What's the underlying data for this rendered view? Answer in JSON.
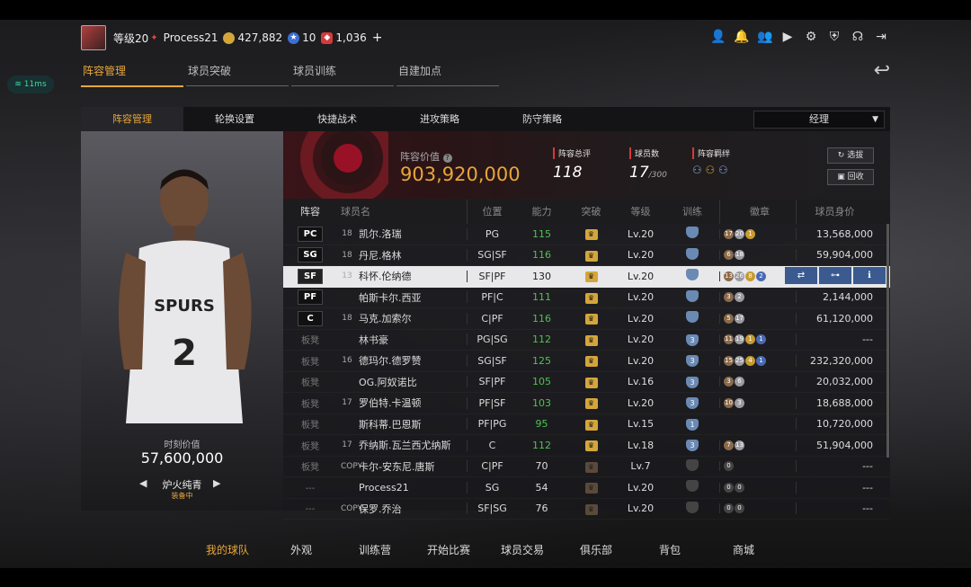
{
  "header": {
    "level_label": "等级20",
    "username": "Process21",
    "gold": "427,882",
    "stars": "10",
    "tickets": "1,036",
    "plus": "+"
  },
  "ping": "11ms",
  "main_tabs": [
    "阵容管理",
    "球员突破",
    "球员训练",
    "自建加点"
  ],
  "sub_tabs": [
    "阵容管理",
    "轮换设置",
    "快捷战术",
    "进攻策略",
    "防守策略"
  ],
  "manager_select": "经理",
  "team": {
    "value_label": "阵容价值",
    "value": "903,920,000",
    "rating_label": "阵容总评",
    "rating": "118",
    "count_label": "球员数",
    "count": "17",
    "count_max": "/300",
    "bond_label": "阵容羁绊",
    "btn_select": "选拔",
    "btn_recycle": "回收"
  },
  "player_card": {
    "jersey_team": "SPURS",
    "jersey_number": "2",
    "value_label": "时刻价值",
    "value": "57,600,000",
    "card_name": "炉火纯青",
    "card_status": "装备中"
  },
  "table": {
    "headers": [
      "阵容",
      "球员名",
      "位置",
      "能力",
      "突破",
      "等级",
      "训练",
      "徽章",
      "球员身价"
    ],
    "rows": [
      {
        "pos": "PC",
        "num": "18",
        "name": "凯尔.洛瑞",
        "position": "PG",
        "ability": "115",
        "level": "Lv.20",
        "train": "",
        "badges": [
          "17",
          "20",
          "1"
        ],
        "value": "13,568,000"
      },
      {
        "pos": "SG",
        "num": "18",
        "name": "丹尼.格林",
        "position": "SG|SF",
        "ability": "116",
        "level": "Lv.20",
        "train": "",
        "badges": [
          "6",
          "18"
        ],
        "value": "59,904,000"
      },
      {
        "pos": "SF",
        "num": "13",
        "name": "科怀.伦纳德",
        "position": "SF|PF",
        "ability": "130",
        "level": "Lv.20",
        "train": "",
        "badges": [
          "13",
          "26",
          "8",
          "2"
        ],
        "value": ""
      },
      {
        "pos": "PF",
        "num": "",
        "name": "帕斯卡尔.西亚",
        "position": "PF|C",
        "ability": "111",
        "level": "Lv.20",
        "train": "",
        "badges": [
          "3",
          "2"
        ],
        "value": "2,144,000"
      },
      {
        "pos": "C",
        "num": "18",
        "name": "马克.加索尔",
        "position": "C|PF",
        "ability": "116",
        "level": "Lv.20",
        "train": "",
        "badges": [
          "5",
          "17"
        ],
        "value": "61,120,000"
      },
      {
        "pos": "板凳",
        "num": "",
        "name": "林书豪",
        "position": "PG|SG",
        "ability": "112",
        "level": "Lv.20",
        "train": "3",
        "badges": [
          "11",
          "19",
          "1",
          "1"
        ],
        "value": "---"
      },
      {
        "pos": "板凳",
        "num": "16",
        "name": "德玛尔.德罗赞",
        "position": "SG|SF",
        "ability": "125",
        "level": "Lv.20",
        "train": "3",
        "badges": [
          "15",
          "25",
          "4",
          "1"
        ],
        "value": "232,320,000"
      },
      {
        "pos": "板凳",
        "num": "",
        "name": "OG.阿奴诺比",
        "position": "SF|PF",
        "ability": "105",
        "level": "Lv.16",
        "train": "3",
        "badges": [
          "3",
          "6"
        ],
        "value": "20,032,000"
      },
      {
        "pos": "板凳",
        "num": "17",
        "name": "罗伯特.卡温顿",
        "position": "PF|SF",
        "ability": "103",
        "level": "Lv.20",
        "train": "3",
        "badges": [
          "10",
          "3"
        ],
        "value": "18,688,000"
      },
      {
        "pos": "板凳",
        "num": "",
        "name": "斯科蒂.巴恩斯",
        "position": "PF|PG",
        "ability": "95",
        "level": "Lv.15",
        "train": "1",
        "badges": [],
        "value": "10,720,000"
      },
      {
        "pos": "板凳",
        "num": "17",
        "name": "乔纳斯.瓦兰西尤纳斯",
        "position": "C",
        "ability": "112",
        "level": "Lv.18",
        "train": "3",
        "badges": [
          "7",
          "13"
        ],
        "value": "51,904,000"
      },
      {
        "pos": "板凳",
        "num": "COPY",
        "name": "卡尔-安东尼.唐斯",
        "position": "C|PF",
        "ability": "70",
        "level": "Lv.7",
        "train": "",
        "badges": [
          "0"
        ],
        "value": "---"
      },
      {
        "pos": "---",
        "num": "",
        "name": "Process21",
        "position": "SG",
        "ability": "54",
        "level": "Lv.20",
        "train": "",
        "badges": [
          "0",
          "0"
        ],
        "value": "---"
      },
      {
        "pos": "---",
        "num": "COPY",
        "name": "保罗.乔治",
        "position": "SF|SG",
        "ability": "76",
        "level": "Lv.20",
        "train": "",
        "badges": [
          "0",
          "0"
        ],
        "value": "---"
      }
    ]
  },
  "bottom_nav": [
    "我的球队",
    "外观",
    "训练营",
    "开始比赛",
    "球员交易",
    "俱乐部",
    "背包",
    "商城"
  ],
  "colors": {
    "accent": "#e8a63a",
    "green": "#4fc24f",
    "team_red": "#c8102e"
  }
}
